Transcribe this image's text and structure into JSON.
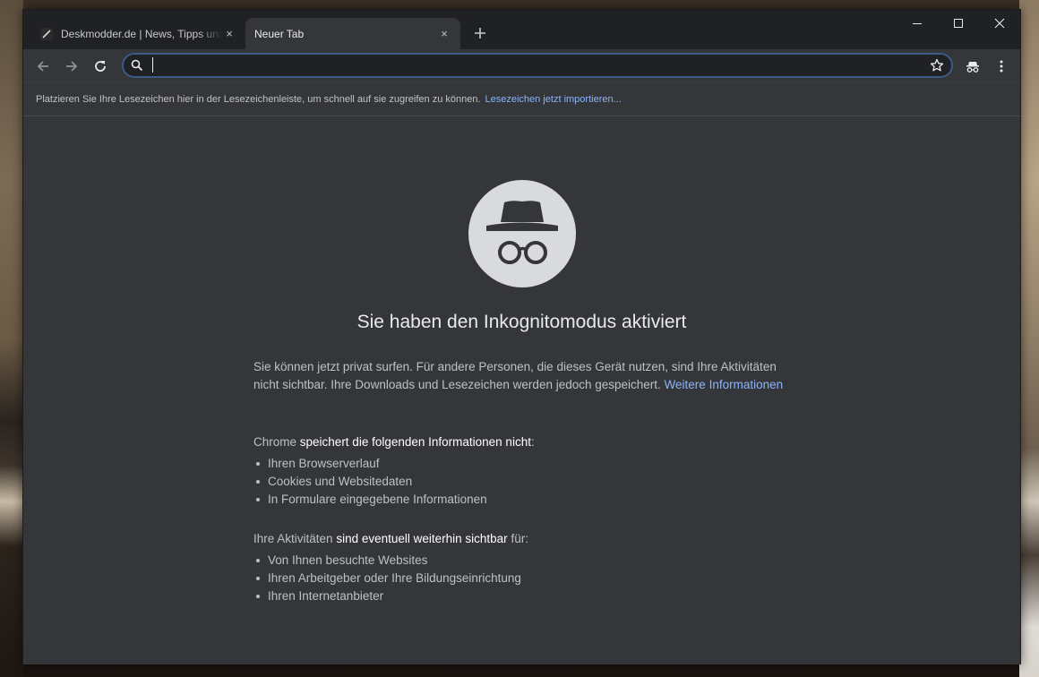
{
  "tabs": [
    {
      "title": "Deskmodder.de | News, Tipps und Tricks",
      "close": "×"
    },
    {
      "title": "Neuer Tab",
      "close": "×"
    }
  ],
  "new_tab_label": "+",
  "window_controls": {
    "minimize": "minimize-icon",
    "maximize": "maximize-icon",
    "close": "close-icon"
  },
  "toolbar": {
    "back": "back-arrow-icon",
    "forward": "forward-arrow-icon",
    "reload": "reload-icon",
    "omnibox_value": "",
    "bookmark_star": "star-icon",
    "incognito_badge": "incognito-icon",
    "menu": "kebab-menu-icon"
  },
  "bookmark_bar": {
    "text": "Platzieren Sie Ihre Lesezeichen hier in der Lesezeichenleiste, um schnell auf sie zugreifen zu können.",
    "link": "Lesezeichen jetzt importieren..."
  },
  "content": {
    "heading": "Sie haben den Inkognitomodus aktiviert",
    "intro": "Sie können jetzt privat surfen. Für andere Personen, die dieses Gerät nutzen, sind Ihre Aktivitäten nicht sichtbar. Ihre Downloads und Lesezeichen werden jedoch gespeichert.",
    "intro_link": "Weitere Informationen",
    "section1": {
      "prefix": "Chrome",
      "strong": "speichert die folgenden Informationen nicht",
      "suffix": ":",
      "items": [
        "Ihren Browserverlauf",
        "Cookies und Websitedaten",
        "In Formulare eingegebene Informationen"
      ]
    },
    "section2": {
      "prefix": "Ihre Aktivitäten",
      "strong": "sind eventuell weiterhin sichtbar",
      "suffix": "für:",
      "items": [
        "Von Ihnen besuchte Websites",
        "Ihren Arbeitgeber oder Ihre Bildungseinrichtung",
        "Ihren Internetanbieter"
      ]
    }
  },
  "colors": {
    "frame": "#202124",
    "toolbar": "#35363a",
    "omnibox_border": "#3b5a86",
    "link": "#8ab4f8",
    "text": "#bdc1c6"
  }
}
